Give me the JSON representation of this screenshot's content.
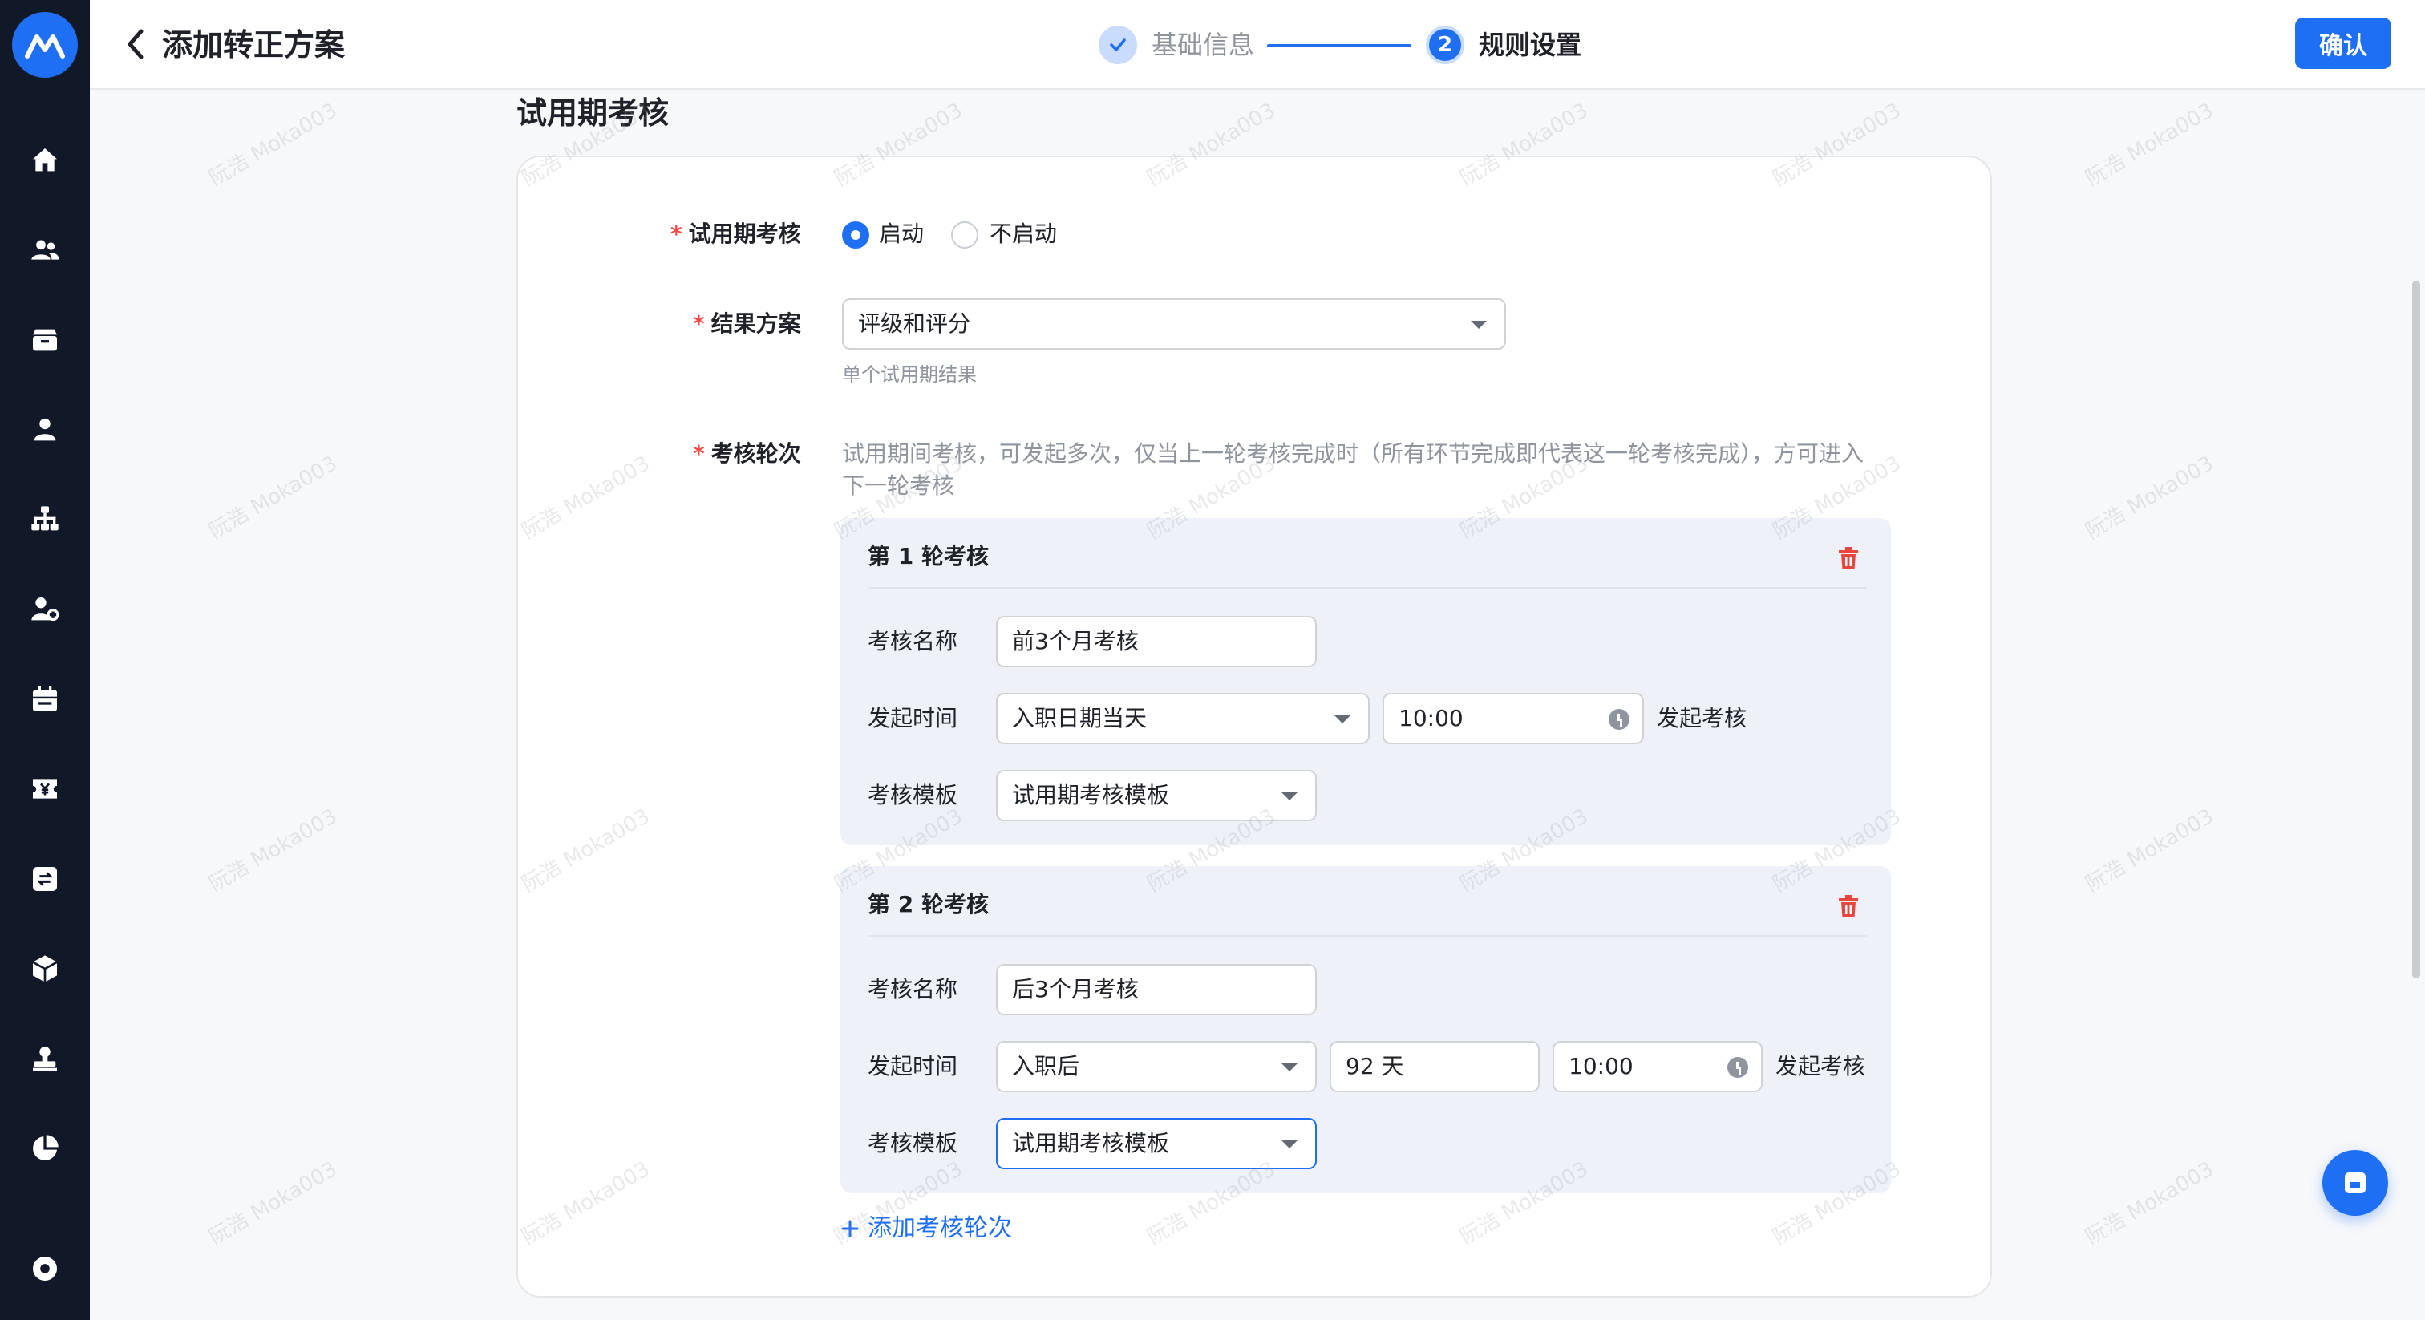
{
  "header": {
    "title": "添加转正方案",
    "steps": [
      {
        "label": "基础信息",
        "state": "done"
      },
      {
        "label": "规则设置",
        "number": "2",
        "state": "active"
      }
    ],
    "confirm_label": "确认"
  },
  "sidebar": {
    "icons": [
      "home-icon",
      "users-icon",
      "box-icon",
      "person-icon",
      "org-chart-icon",
      "person-add-icon",
      "calendar-icon",
      "yen-ticket-icon",
      "transfer-icon",
      "cube-icon",
      "stamp-icon",
      "pie-chart-icon",
      "settings-icon"
    ]
  },
  "section": {
    "title": "试用期考核",
    "probation_field": {
      "label": "试用期考核",
      "options": [
        {
          "label": "启动",
          "selected": true
        },
        {
          "label": "不启动",
          "selected": false
        }
      ]
    },
    "result_field": {
      "label": "结果方案",
      "value": "评级和评分",
      "hint": "单个试用期结果"
    },
    "rounds_field": {
      "label": "考核轮次",
      "description": "试用期间考核，可发起多次，仅当上一轮考核完成时（所有环节完成即代表这一轮考核完成），方可进入下一轮考核"
    },
    "rounds": [
      {
        "title": "第 1 轮考核",
        "name_label": "考核名称",
        "name_value": "前3个月考核",
        "time_label": "发起时间",
        "time_type": "入职日期当天",
        "time_value": "10:00",
        "time_suffix": "发起考核",
        "template_label": "考核模板",
        "template_value": "试用期考核模板"
      },
      {
        "title": "第 2 轮考核",
        "name_label": "考核名称",
        "name_value": "后3个月考核",
        "time_label": "发起时间",
        "time_type": "入职后",
        "days_value": "92 天",
        "time_value": "10:00",
        "time_suffix": "发起考核",
        "template_label": "考核模板",
        "template_value": "试用期考核模板"
      }
    ],
    "add_round_label": "添加考核轮次"
  },
  "watermark": "阮浩 Moka003",
  "colors": {
    "primary": "#1f6ff5",
    "sidebar": "#111827",
    "required": "#f54a45",
    "danger": "#e8463d",
    "round_bg": "#eef2f8"
  }
}
